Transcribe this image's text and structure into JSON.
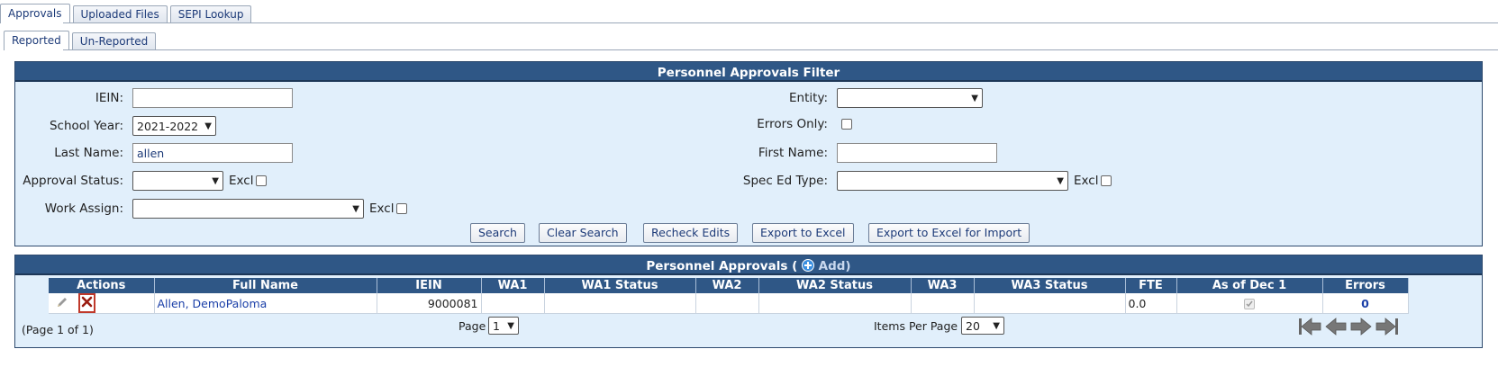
{
  "top_tabs": [
    {
      "label": "Approvals",
      "active": true
    },
    {
      "label": "Uploaded Files",
      "active": false
    },
    {
      "label": "SEPI Lookup",
      "active": false
    }
  ],
  "sub_tabs": [
    {
      "label": "Reported",
      "active": true
    },
    {
      "label": "Un-Reported",
      "active": false
    }
  ],
  "filter": {
    "title": "Personnel Approvals Filter",
    "ieln_label": "IEIN:",
    "ieln_value": "",
    "school_year_label": "School Year:",
    "school_year_value": "2021-2022",
    "last_name_label": "Last Name:",
    "last_name_value": "allen",
    "approval_status_label": "Approval Status:",
    "approval_status_value": "",
    "work_assign_label": "Work Assign:",
    "work_assign_value": "",
    "entity_label": "Entity:",
    "entity_value": "",
    "errors_only_label": "Errors Only:",
    "first_name_label": "First Name:",
    "first_name_value": "",
    "spec_ed_label": "Spec Ed Type:",
    "spec_ed_value": "",
    "excl_label": "Excl",
    "buttons": {
      "search": "Search",
      "clear": "Clear Search",
      "recheck": "Recheck Edits",
      "export": "Export to Excel",
      "export_import": "Export to Excel for Import"
    }
  },
  "approvals": {
    "title": "Personnel Approvals (",
    "add_label": "Add)",
    "columns": [
      "Actions",
      "Full Name",
      "IEIN",
      "WA1",
      "WA1 Status",
      "WA2",
      "WA2 Status",
      "WA3",
      "WA3 Status",
      "FTE",
      "As of Dec 1",
      "Errors"
    ],
    "rows": [
      {
        "full_name": "Allen, DemoPaloma",
        "iein": "9000081",
        "wa1": "",
        "wa1_status": "",
        "wa2": "",
        "wa2_status": "",
        "wa3": "",
        "wa3_status": "",
        "fte": "0.0",
        "as_of_dec1": true,
        "errors": "0"
      }
    ],
    "page_info": "(Page 1 of 1)",
    "page_label": "Page",
    "page_value": "1",
    "items_per_page_label": "Items Per Page",
    "items_per_page_value": "20"
  }
}
